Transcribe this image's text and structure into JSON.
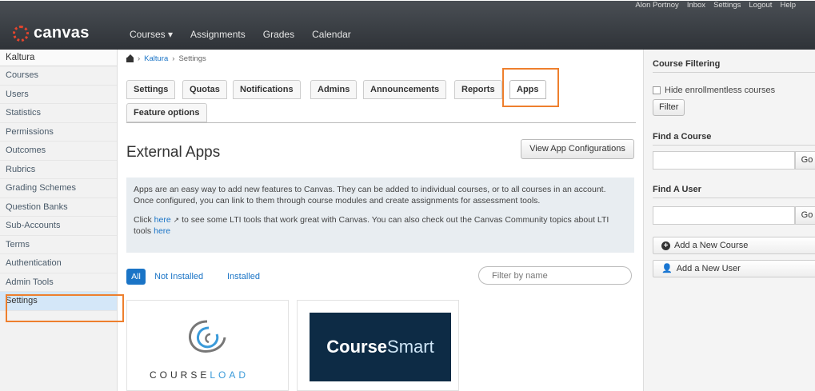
{
  "header": {
    "user_links": [
      "Alon Portnoy",
      "Inbox",
      "Settings",
      "Logout",
      "Help"
    ],
    "logo_text": "canvas",
    "nav": [
      "Courses ▾",
      "Assignments",
      "Grades",
      "Calendar"
    ]
  },
  "sidebar": {
    "title": "Kaltura",
    "items": [
      "Courses",
      "Users",
      "Statistics",
      "Permissions",
      "Outcomes",
      "Rubrics",
      "Grading Schemes",
      "Question Banks",
      "Sub-Accounts",
      "Terms",
      "Authentication",
      "Admin Tools",
      "Settings"
    ],
    "active": "Settings"
  },
  "breadcrumb": {
    "root": "Kaltura",
    "current": "Settings",
    "sep": "›"
  },
  "tabs": [
    "Settings",
    "Quotas",
    "Notifications",
    "Admins",
    "Announcements",
    "Reports",
    "Apps",
    "Feature options"
  ],
  "main": {
    "heading": "External Apps",
    "view_configs": "View App Configurations",
    "info_p1": "Apps are an easy way to add new features to Canvas. They can be added to individual courses, or to all courses in an account. Once configured, you can link to them through course modules and create assignments for assessment tools.",
    "info_p2_a": "Click ",
    "info_p2_link": "here",
    "info_p2_b": " to see some LTI tools that work great with Canvas. You can also check out the Canvas Community topics about LTI tools ",
    "info_p2_link2": "here",
    "filter_all": "All",
    "filter_not_installed": "Not Installed",
    "filter_installed": "Installed",
    "filter_placeholder": "Filter by name",
    "app1_name_a": "COURSE",
    "app1_name_b": "LOAD",
    "app2_name_a": "Course",
    "app2_name_b": "Smart"
  },
  "right": {
    "course_filtering": "Course Filtering",
    "hide_label": "Hide enrollmentless courses",
    "filter_btn": "Filter",
    "find_course": "Find a Course",
    "go": "Go",
    "find_user": "Find A User",
    "add_course": "Add a New Course",
    "add_user": "Add a New User"
  },
  "colors": {
    "accent": "#1a74c6",
    "highlight_box": "#ee7f2d"
  }
}
